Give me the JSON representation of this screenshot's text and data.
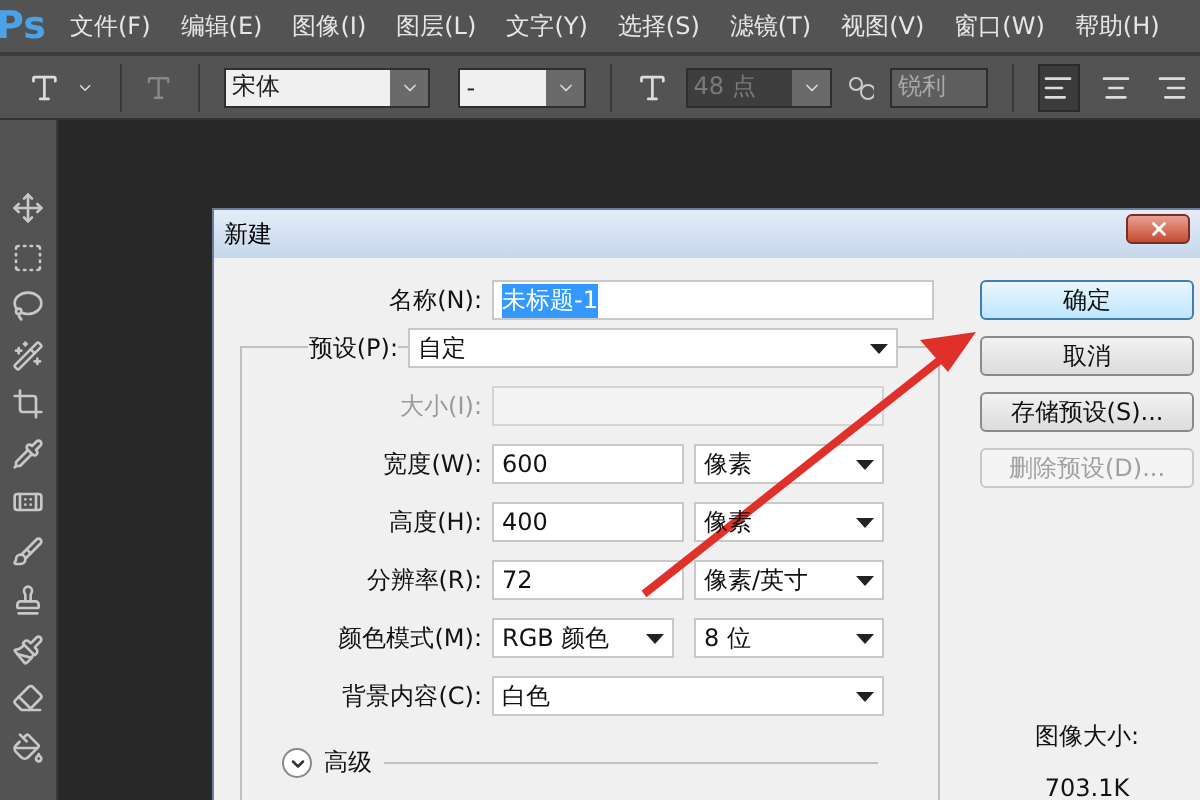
{
  "menu_bar": {
    "logo": "Ps",
    "items": [
      "文件(F)",
      "编辑(E)",
      "图像(I)",
      "图层(L)",
      "文字(Y)",
      "选择(S)",
      "滤镜(T)",
      "视图(V)",
      "窗口(W)",
      "帮助(H)"
    ]
  },
  "options_bar": {
    "font_family": "宋体",
    "font_style": "-",
    "font_size": "48 点",
    "antialias": "锐利",
    "alignment": [
      {
        "selected": true
      },
      {
        "selected": false
      },
      {
        "selected": false
      }
    ]
  },
  "dialog": {
    "title": "新建",
    "name": {
      "label": "名称(N):",
      "value": "未标题-1",
      "selected": true
    },
    "fields": [
      {
        "kind": "preset",
        "label": "预设(P):",
        "value": "自定",
        "disabled": false
      },
      {
        "kind": "size",
        "label": "大小(I):",
        "disabled": true
      },
      {
        "kind": "measure",
        "label": "宽度(W):",
        "value": "600",
        "unit": "像素",
        "disabled": false
      },
      {
        "kind": "measure",
        "label": "高度(H):",
        "value": "400",
        "unit": "像素",
        "disabled": false
      },
      {
        "kind": "measure",
        "label": "分辨率(R):",
        "value": "72",
        "unit": "像素/英寸",
        "disabled": false
      },
      {
        "kind": "mode",
        "label": "颜色模式(M):",
        "value": "RGB 颜色",
        "unit": "8 位",
        "disabled": false
      },
      {
        "kind": "select",
        "label": "背景内容(C):",
        "value": "白色",
        "disabled": false
      }
    ],
    "advanced": {
      "label": "高级",
      "expanded": false
    },
    "buttons": [
      {
        "label": "确定",
        "default": true,
        "disabled": false
      },
      {
        "label": "取消",
        "default": false,
        "disabled": false
      },
      {
        "label": "存储预设(S)...",
        "default": false,
        "disabled": false
      },
      {
        "label": "删除预设(D)...",
        "default": false,
        "disabled": true
      }
    ],
    "image_size": {
      "label": "图像大小:",
      "value": "703.1K"
    }
  }
}
